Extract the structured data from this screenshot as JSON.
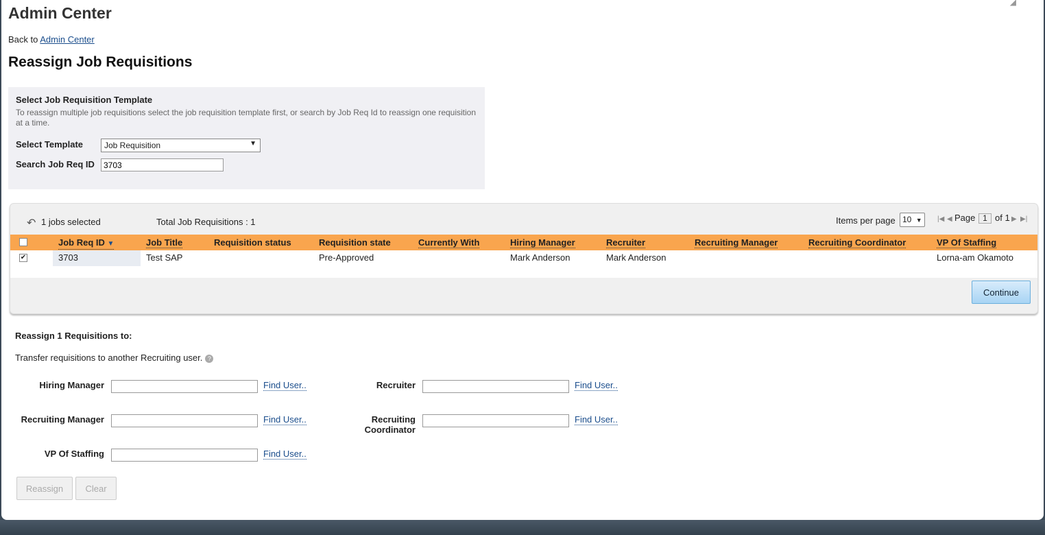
{
  "header": {
    "title": "Admin Center",
    "back_prefix": "Back to",
    "back_link": "Admin Center",
    "page_heading": "Reassign Job Requisitions"
  },
  "template_section": {
    "title": "Select Job Requisition Template",
    "description": "To reassign multiple job requisitions select the job requisition template first, or search by Job Req Id to reassign one requisition at a time.",
    "select_label": "Select Template",
    "select_value": "Job Requisition",
    "search_label": "Search Job Req ID",
    "search_value": "3703"
  },
  "grid": {
    "selected_text": "1 jobs selected",
    "total_text": "Total Job Requisitions : 1",
    "items_per_page_label": "Items per page",
    "items_per_page_value": "10",
    "page_label": "Page",
    "page_value": "1",
    "of_label": "of 1",
    "columns": [
      "Job Req ID",
      "Job Title",
      "Requisition status",
      "Requisition state",
      "Currently With",
      "Hiring Manager",
      "Recruiter",
      "Recruiting Manager",
      "Recruiting Coordinator",
      "VP Of Staffing"
    ],
    "rows": [
      {
        "job_req_id": "3703",
        "job_title": "Test SAP",
        "requisition_status": "",
        "requisition_state": "Pre-Approved",
        "currently_with": "",
        "hiring_manager": "Mark Anderson",
        "recruiter": "Mark Anderson",
        "recruiting_manager": "",
        "recruiting_coordinator": "",
        "vp_of_staffing": "Lorna-am Okamoto",
        "checked": true
      }
    ],
    "continue_label": "Continue"
  },
  "reassign": {
    "title": "Reassign 1 Requisitions to:",
    "transfer_text": "Transfer requisitions to another Recruiting user.",
    "find_user_label": "Find User..",
    "fields": {
      "hiring_manager": "Hiring Manager",
      "recruiter": "Recruiter",
      "recruiting_manager": "Recruiting Manager",
      "recruiting_coordinator_line1": "Recruiting",
      "recruiting_coordinator_line2": "Coordinator",
      "vp_of_staffing": "VP Of Staffing"
    },
    "reassign_label": "Reassign",
    "clear_label": "Clear"
  },
  "colors": {
    "header_orange": "#f9a54e",
    "link_blue": "#1a4d8c",
    "continue_blue": "#a8d4f4"
  }
}
